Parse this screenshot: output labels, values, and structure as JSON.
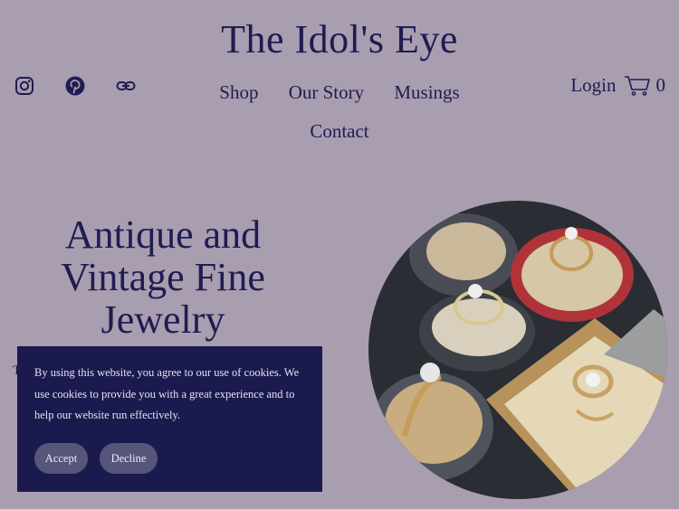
{
  "header": {
    "title": "The Idol's Eye",
    "social_icons": [
      "instagram-icon",
      "pinterest-icon",
      "link-icon"
    ]
  },
  "nav": {
    "items": [
      "Shop",
      "Our Story",
      "Musings"
    ],
    "contact": "Contact"
  },
  "account": {
    "login": "Login",
    "cart_icon": "cart-icon",
    "cart_count": "0"
  },
  "hero": {
    "title_lines": [
      "Antique and",
      "Vintage Fine",
      "Jewelry"
    ],
    "partial_text": "T"
  },
  "cookie": {
    "message": "By using this website, you agree to our use of cookies. We use cookies to provide you with a great experience and to help our website run effectively.",
    "accept": "Accept",
    "decline": "Decline"
  },
  "colors": {
    "background": "#a99db0",
    "text": "#1f1c52",
    "banner": "#1b1a4f",
    "button": "#56557a"
  }
}
